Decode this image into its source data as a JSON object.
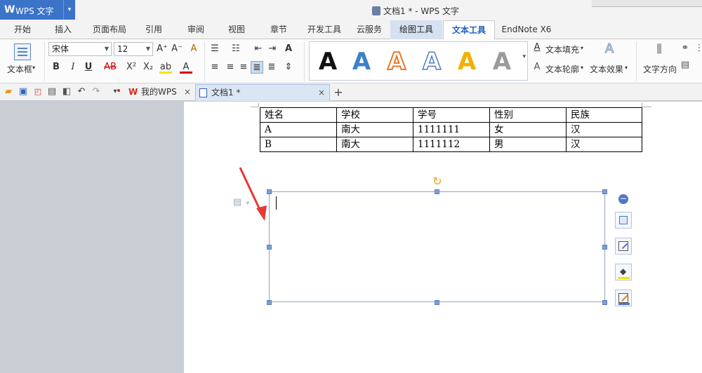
{
  "app": {
    "logo": "W",
    "name": "WPS 文字",
    "dropdown": "▾"
  },
  "window": {
    "title": "文档1 * - WPS 文字"
  },
  "menu": [
    {
      "id": "start",
      "label": "开始"
    },
    {
      "id": "insert",
      "label": "插入"
    },
    {
      "id": "layout",
      "label": "页面布局"
    },
    {
      "id": "reference",
      "label": "引用"
    },
    {
      "id": "review",
      "label": "审阅"
    },
    {
      "id": "view",
      "label": "视图"
    },
    {
      "id": "chapter",
      "label": "章节"
    },
    {
      "id": "dev",
      "label": "开发工具"
    },
    {
      "id": "cloud",
      "label": "云服务"
    },
    {
      "id": "draw",
      "label": "绘图工具"
    },
    {
      "id": "text",
      "label": "文本工具"
    },
    {
      "id": "endnote",
      "label": "EndNote X6"
    }
  ],
  "ribbon": {
    "textbox_label": "文本框",
    "font_name": "宋体",
    "font_size": "12",
    "grow_font": "A⁺",
    "shrink_font": "A⁻",
    "clear_format": "A",
    "bold": "B",
    "italic": "I",
    "underline": "U",
    "strike": "AB",
    "superscript": "X²",
    "subscript": "X₂",
    "highlight": "ab",
    "font_color": "A",
    "gallery_letter": "A",
    "text_fill": "文本填充",
    "text_outline": "文本轮廓",
    "text_effect": "文本效果",
    "text_direction": "文字方向"
  },
  "quick_tabs": {
    "my_wps": "我的WPS",
    "doc": "文档1 *",
    "close": "×",
    "new": "+"
  },
  "table": {
    "rows": [
      [
        "姓名",
        "学校",
        "学号",
        "性别",
        "民族"
      ],
      [
        "A",
        "南大",
        "1111111",
        "女",
        "汉"
      ],
      [
        "B",
        "南大",
        "1111112",
        "男",
        "汉"
      ]
    ]
  },
  "colors": {
    "accent": "#3b73c9",
    "tab_active": "#1c5fbf",
    "arrow": "#e53935",
    "rotate_handle": "#f0a020"
  }
}
